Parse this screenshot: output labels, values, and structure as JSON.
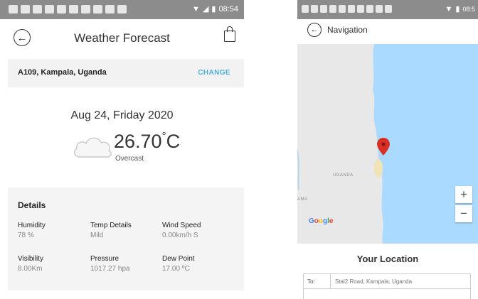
{
  "weather": {
    "title": "Weather Forecast",
    "address": "A109, Kampala, Uganda",
    "change_label": "CHANGE",
    "date": "Aug 24, Friday 2020",
    "temperature": "26.70",
    "temperature_unit": "C",
    "condition": "Overcast",
    "details_title": "Details",
    "details": [
      {
        "label": "Humidity",
        "value": "78 %"
      },
      {
        "label": "Temp Details",
        "value": "Mild"
      },
      {
        "label": "Wind Speed",
        "value": "0.00km/h S"
      },
      {
        "label": "Visibility",
        "value": "8.00Km"
      },
      {
        "label": "Pressure",
        "value": "1017.27 hpa"
      },
      {
        "label": "Dew Point",
        "value": "17.00 ºC"
      }
    ],
    "status_time": "08:54"
  },
  "navigation": {
    "title": "Navigation",
    "map_label": "UGANDA",
    "map_label_2": "AMA",
    "zoom_in": "+",
    "zoom_out": "−",
    "google_logo": "Google",
    "location_title": "Your Location",
    "to_label": "To:",
    "to_value": "Stal2 Road, Kampala, Uganda",
    "status_time": "08:5"
  },
  "colors": {
    "accent": "#4fb0da",
    "water": "#aadaff",
    "land": "#e8e8e8",
    "marker": "#d93025"
  }
}
